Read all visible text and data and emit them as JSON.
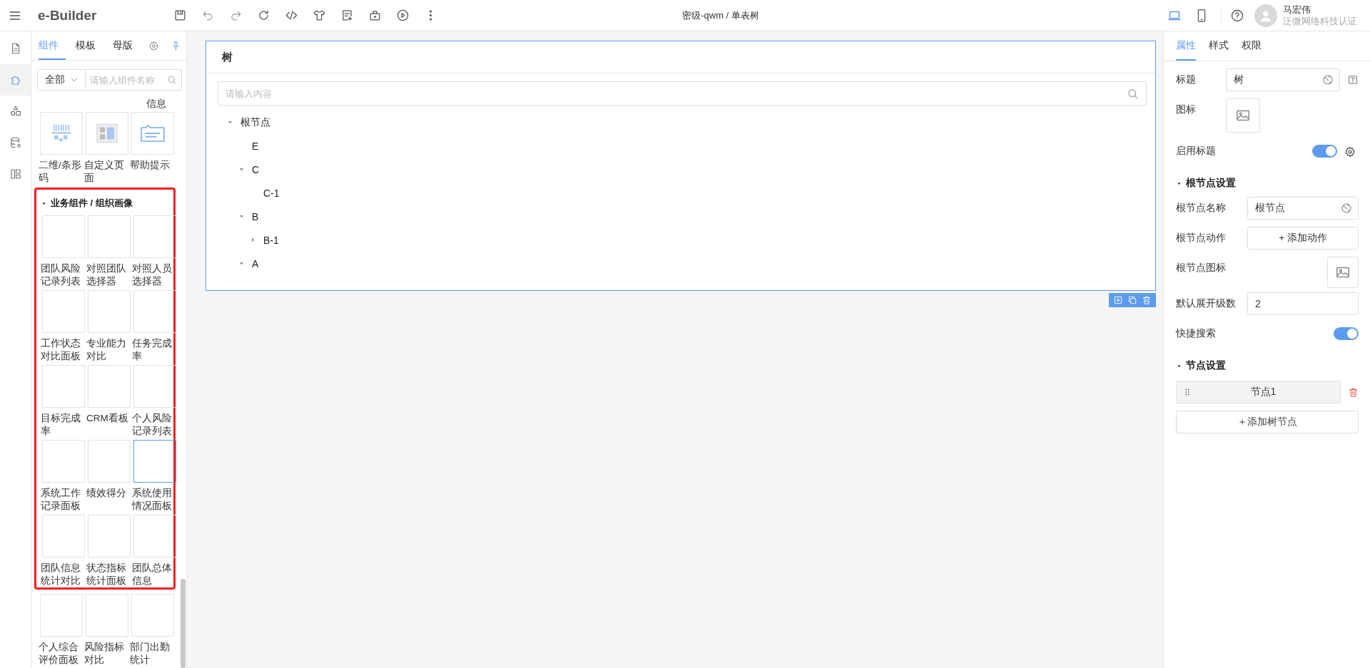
{
  "topbar": {
    "app_name": "e-Builder",
    "title": "密级-qwm / 单表树",
    "devices": [
      {
        "kind": "desktop",
        "selected": true
      },
      {
        "kind": "mobile",
        "selected": false
      }
    ],
    "user": {
      "name": "马宏伟",
      "org": "泛微网络科技认证"
    }
  },
  "rail": [
    {
      "kind": "page",
      "selected": false
    },
    {
      "kind": "component",
      "selected": true
    },
    {
      "kind": "shapes",
      "selected": false
    },
    {
      "kind": "data",
      "selected": false
    },
    {
      "kind": "layout",
      "selected": false
    }
  ],
  "components": {
    "tabs": [
      {
        "label": "组件",
        "selected": true
      },
      {
        "label": "模板",
        "selected": false
      },
      {
        "label": "母版",
        "selected": false
      }
    ],
    "filter": {
      "value": "全部"
    },
    "search": {
      "placeholder": "请输入组件名称"
    },
    "cut_label": "信息",
    "items": [
      {
        "label": "二维/条形码",
        "kind": "code",
        "selected": false
      },
      {
        "label": "自定义页面",
        "kind": "page",
        "selected": false
      },
      {
        "label": "帮助提示",
        "kind": "tip",
        "selected": false
      }
    ],
    "group": {
      "title": "业务组件 / 组织画像",
      "expanded": true,
      "highlighted": true,
      "items": [
        {
          "label": "团队风险记录列表",
          "selected": false
        },
        {
          "label": "对照团队选择器",
          "selected": false
        },
        {
          "label": "对照人员选择器",
          "selected": false
        },
        {
          "label": "工作状态对比面板",
          "selected": false
        },
        {
          "label": "专业能力对比",
          "selected": false
        },
        {
          "label": "任务完成率",
          "selected": false
        },
        {
          "label": "目标完成率",
          "selected": false
        },
        {
          "label": "CRM看板",
          "selected": false
        },
        {
          "label": "个人风险记录列表",
          "selected": false
        },
        {
          "label": "系统工作记录面板",
          "selected": false
        },
        {
          "label": "绩效得分",
          "selected": false
        },
        {
          "label": "系统使用情况面板",
          "selected": true
        },
        {
          "label": "团队信息统计对比",
          "selected": false
        },
        {
          "label": "状态指标统计面板",
          "selected": false
        },
        {
          "label": "团队总体信息",
          "selected": false
        }
      ]
    },
    "more_items": [
      {
        "label": "个人综合评价面板",
        "selected": false
      },
      {
        "label": "风险指标对比",
        "selected": false
      },
      {
        "label": "部门出勤统计",
        "selected": false
      }
    ]
  },
  "canvas": {
    "card": {
      "title": "树",
      "selected": true,
      "search": {
        "placeholder": "请输入内容"
      },
      "tree": [
        {
          "label": "根节点",
          "expanded": true,
          "children": [
            {
              "label": "E"
            },
            {
              "label": "C",
              "expanded": true,
              "children": [
                {
                  "label": "C-1"
                }
              ]
            },
            {
              "label": "B",
              "expanded": true,
              "children": [
                {
                  "label": "B-1",
                  "expanded": false
                }
              ]
            },
            {
              "label": "A",
              "expanded": true
            }
          ]
        }
      ]
    }
  },
  "properties": {
    "tabs": [
      {
        "label": "属性",
        "selected": true
      },
      {
        "label": "样式",
        "selected": false
      },
      {
        "label": "权限",
        "selected": false
      }
    ],
    "rows": [
      {
        "kind": "text",
        "label": "标题",
        "value": "树",
        "format_button": true
      },
      {
        "kind": "image",
        "label": "图标"
      },
      {
        "kind": "toggle",
        "label": "启用标题",
        "on": true,
        "settings_button": true
      }
    ],
    "sections": [
      {
        "title": "根节点设置",
        "expanded": true,
        "rows": [
          {
            "kind": "text",
            "label": "根节点名称",
            "value": "根节点"
          },
          {
            "kind": "action",
            "label": "根节点动作",
            "button": "+ 添加动作"
          },
          {
            "kind": "image",
            "label": "根节点图标"
          },
          {
            "kind": "number",
            "label": "默认展开级数",
            "value": "2"
          },
          {
            "kind": "toggle",
            "label": "快捷搜索",
            "on": true
          }
        ]
      },
      {
        "title": "节点设置",
        "expanded": true,
        "nodes": [
          {
            "label": "节点1"
          }
        ],
        "add_button": "＋添加树节点"
      }
    ]
  }
}
